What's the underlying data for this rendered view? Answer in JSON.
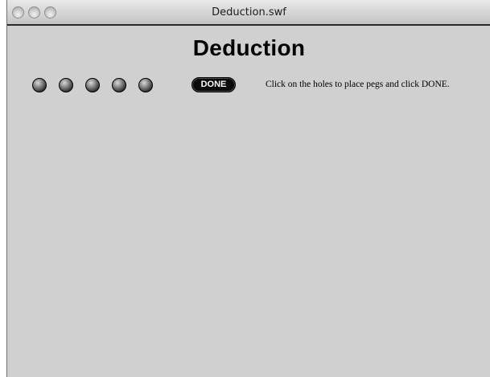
{
  "window": {
    "title": "Deduction.swf"
  },
  "game": {
    "title": "Deduction",
    "holes": [
      {
        "label": "",
        "icon": "peg-hole"
      },
      {
        "label": "",
        "icon": "peg-hole"
      },
      {
        "label": "",
        "icon": "peg-hole"
      },
      {
        "label": "",
        "icon": "peg-hole"
      },
      {
        "label": "",
        "icon": "peg-hole"
      }
    ],
    "done_label": "DONE",
    "instructions": "Click on the holes to place pegs and click DONE."
  },
  "colors": {
    "background": "#d0d0d0",
    "button": "#0a0a0a",
    "text": "#000000"
  }
}
